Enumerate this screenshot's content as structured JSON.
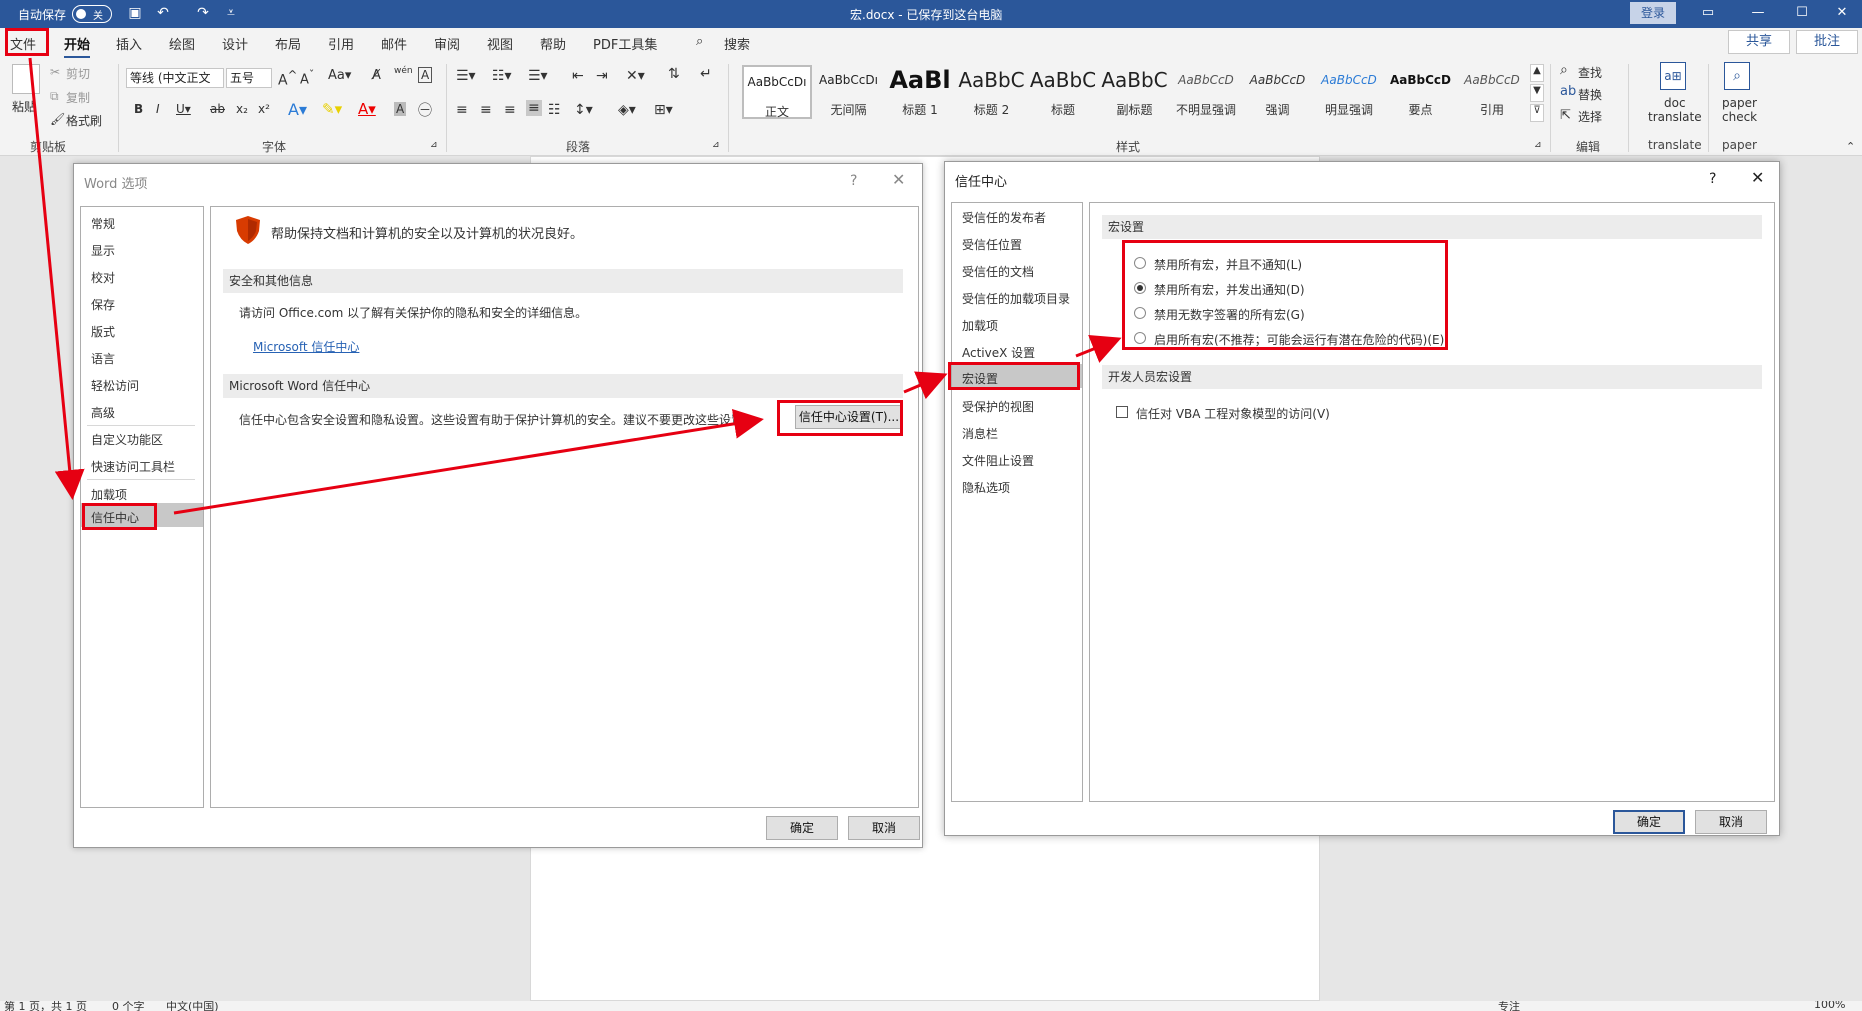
{
  "titlebar": {
    "autosave_label": "自动保存",
    "autosave_state": "关",
    "doc_title": "宏.docx - 已保存到这台电脑",
    "login": "登录"
  },
  "menu": {
    "tabs": [
      "文件",
      "开始",
      "插入",
      "绘图",
      "设计",
      "布局",
      "引用",
      "邮件",
      "审阅",
      "视图",
      "帮助",
      "PDF工具集"
    ],
    "search": "搜索",
    "share": "共享",
    "comment": "批注"
  },
  "ribbon": {
    "clipboard": {
      "paste": "粘贴",
      "cut": "剪切",
      "copy": "复制",
      "format_painter": "格式刷",
      "label": "剪贴板"
    },
    "font": {
      "name": "等线 (中文正文",
      "size": "五号",
      "label": "字体"
    },
    "paragraph": {
      "label": "段落"
    },
    "styles": {
      "label": "样式",
      "items": [
        {
          "sample": "AaBbCcDı",
          "name": "正文"
        },
        {
          "sample": "AaBbCcDı",
          "name": "无间隔"
        },
        {
          "sample": "AaBl",
          "name": "标题 1"
        },
        {
          "sample": "AaBbC",
          "name": "标题 2"
        },
        {
          "sample": "AaBbC",
          "name": "标题"
        },
        {
          "sample": "AaBbC",
          "name": "副标题"
        },
        {
          "sample": "AaBbCcD",
          "name": "不明显强调"
        },
        {
          "sample": "AaBbCcD",
          "name": "强调"
        },
        {
          "sample": "AaBbCcD",
          "name": "明显强调"
        },
        {
          "sample": "AaBbCcD",
          "name": "要点"
        },
        {
          "sample": "AaBbCcD",
          "name": "引用"
        }
      ]
    },
    "editing": {
      "find": "查找",
      "replace": "替换",
      "select": "选择",
      "label": "编辑"
    },
    "translate": {
      "line1": "doc",
      "line2": "translate",
      "label": "translate"
    },
    "paper": {
      "line1": "paper",
      "line2": "check",
      "label": "paper"
    }
  },
  "word_options": {
    "title": "Word 选项",
    "nav": [
      "常规",
      "显示",
      "校对",
      "保存",
      "版式",
      "语言",
      "轻松访问",
      "高级",
      "自定义功能区",
      "快速访问工具栏",
      "加载项",
      "信任中心"
    ],
    "header_text": "帮助保持文档和计算机的安全以及计算机的状况良好。",
    "section1_title": "安全和其他信息",
    "section1_text": "请访问 Office.com 以了解有关保护你的隐私和安全的详细信息。",
    "section1_link": "Microsoft 信任中心",
    "section2_title": "Microsoft Word 信任中心",
    "section2_text": "信任中心包含安全设置和隐私设置。这些设置有助于保护计算机的安全。建议不要更改这些设置。",
    "tc_settings_btn": "信任中心设置(T)...",
    "ok": "确定",
    "cancel": "取消"
  },
  "trust_center": {
    "title": "信任中心",
    "nav": [
      "受信任的发布者",
      "受信任位置",
      "受信任的文档",
      "受信任的加载项目录",
      "加载项",
      "ActiveX 设置",
      "宏设置",
      "受保护的视图",
      "消息栏",
      "文件阻止设置",
      "隐私选项"
    ],
    "macro_section": "宏设置",
    "macro_options": [
      "禁用所有宏，并且不通知(L)",
      "禁用所有宏，并发出通知(D)",
      "禁用无数字签署的所有宏(G)",
      "启用所有宏(不推荐；可能会运行有潜在危险的代码)(E)"
    ],
    "selected_option": 1,
    "dev_section": "开发人员宏设置",
    "vba_checkbox": "信任对 VBA 工程对象模型的访问(V)",
    "ok": "确定",
    "cancel": "取消"
  },
  "statusbar": {
    "page": "第 1 页，共 1 页",
    "words": "0 个字",
    "lang": "中文(中国)",
    "focus": "专注",
    "zoom": "100%"
  },
  "colors": {
    "brand": "#2b579a",
    "annotation": "#e60012"
  }
}
